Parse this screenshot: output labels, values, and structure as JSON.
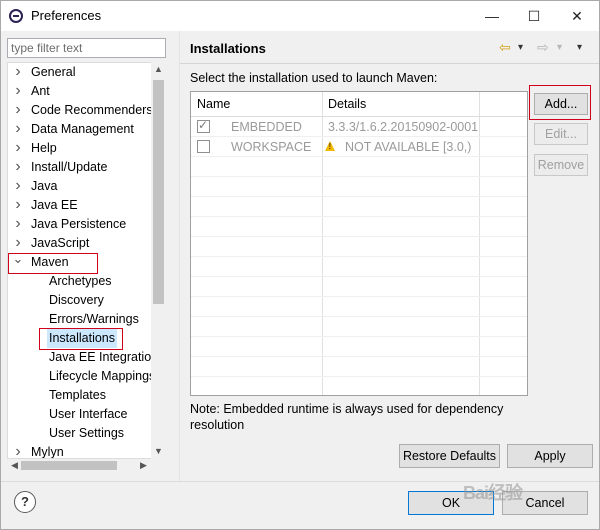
{
  "window": {
    "title": "Preferences",
    "minimize": "—",
    "maximize": "☐",
    "close": "✕"
  },
  "filter": {
    "placeholder": "type filter text"
  },
  "tree": {
    "items": [
      {
        "label": "General",
        "level": 0,
        "state": "collapsed"
      },
      {
        "label": "Ant",
        "level": 0,
        "state": "collapsed"
      },
      {
        "label": "Code Recommenders",
        "level": 0,
        "state": "collapsed"
      },
      {
        "label": "Data Management",
        "level": 0,
        "state": "collapsed"
      },
      {
        "label": "Help",
        "level": 0,
        "state": "collapsed"
      },
      {
        "label": "Install/Update",
        "level": 0,
        "state": "collapsed"
      },
      {
        "label": "Java",
        "level": 0,
        "state": "collapsed"
      },
      {
        "label": "Java EE",
        "level": 0,
        "state": "collapsed"
      },
      {
        "label": "Java Persistence",
        "level": 0,
        "state": "collapsed"
      },
      {
        "label": "JavaScript",
        "level": 0,
        "state": "collapsed"
      },
      {
        "label": "Maven",
        "level": 0,
        "state": "expanded"
      },
      {
        "label": "Archetypes",
        "level": 1
      },
      {
        "label": "Discovery",
        "level": 1
      },
      {
        "label": "Errors/Warnings",
        "level": 1
      },
      {
        "label": "Installations",
        "level": 1,
        "selected": true
      },
      {
        "label": "Java EE Integration",
        "level": 1
      },
      {
        "label": "Lifecycle Mappings",
        "level": 1
      },
      {
        "label": "Templates",
        "level": 1
      },
      {
        "label": "User Interface",
        "level": 1
      },
      {
        "label": "User Settings",
        "level": 1
      },
      {
        "label": "Mylyn",
        "level": 0,
        "state": "collapsed"
      }
    ],
    "chevron_collapsed": "›",
    "chevron_expanded": "⌄"
  },
  "page": {
    "title": "Installations",
    "description": "Select the installation used to launch Maven:",
    "columns": [
      "Name",
      "Details"
    ],
    "rows": [
      {
        "checked": true,
        "name": "EMBEDDED",
        "details": "3.3.3/1.6.2.20150902-0001",
        "warning": false
      },
      {
        "checked": false,
        "name": "WORKSPACE",
        "details": "NOT AVAILABLE [3.0,)",
        "warning": true
      }
    ],
    "note": "Note: Embedded runtime is always used for dependency resolution",
    "nav": {
      "back": "⇦",
      "forward": "⇨",
      "dropdown": "▾",
      "menu": "▾"
    }
  },
  "buttons": {
    "add": "Add...",
    "edit": "Edit...",
    "remove": "Remove",
    "restore_defaults": "Restore Defaults",
    "apply": "Apply",
    "ok": "OK",
    "cancel": "Cancel"
  },
  "help": {
    "label": "?"
  },
  "watermark": "Bai经验",
  "colors": {
    "highlight_box": "#d0021b",
    "selection": "#cce8ff",
    "warning": "#f5b800"
  }
}
